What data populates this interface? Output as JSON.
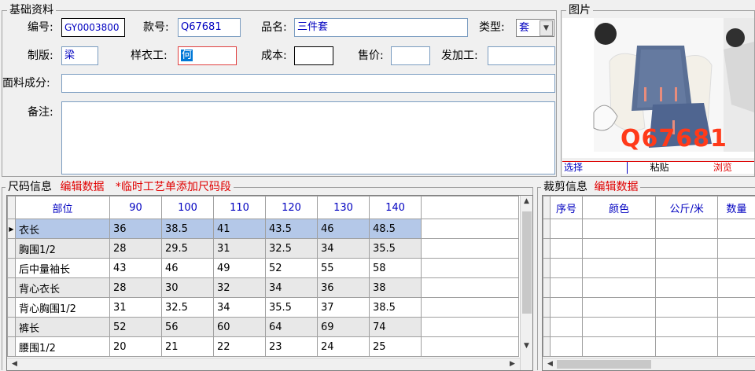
{
  "basic": {
    "title": "基础资料",
    "code_label": "编号:",
    "code_value": "GY0003800",
    "style_label": "款号:",
    "style_value": "Q67681",
    "name_label": "品名:",
    "name_value": "三件套",
    "type_label": "类型:",
    "type_value": "套",
    "pattern_label": "制版:",
    "pattern_value": "梁",
    "sample_label": "样衣工:",
    "sample_value": "何",
    "cost_label": "成本:",
    "cost_value": "",
    "price_label": "售价:",
    "price_value": "",
    "process_label": "发加工:",
    "process_value": "",
    "fabric_label": "面料成分:",
    "fabric_value": "",
    "note_label": "备注:",
    "note_value": ""
  },
  "picture": {
    "title": "图片",
    "caption": "Q67681",
    "select_label": "选择",
    "paste_label": "粘贴",
    "browse_label": "浏览"
  },
  "size": {
    "title": "尺码信息",
    "edit_label": "编辑数据",
    "note": "*临时工艺单添加尺码段",
    "columns": [
      "部位",
      "90",
      "100",
      "110",
      "120",
      "130",
      "140"
    ],
    "rows": [
      [
        "衣长",
        "36",
        "38.5",
        "41",
        "43.5",
        "46",
        "48.5"
      ],
      [
        "胸围1/2",
        "28",
        "29.5",
        "31",
        "32.5",
        "34",
        "35.5"
      ],
      [
        "后中量袖长",
        "43",
        "46",
        "49",
        "52",
        "55",
        "58"
      ],
      [
        "背心衣长",
        "28",
        "30",
        "32",
        "34",
        "36",
        "38"
      ],
      [
        "背心胸围1/2",
        "31",
        "32.5",
        "34",
        "35.5",
        "37",
        "38.5"
      ],
      [
        "裤长",
        "52",
        "56",
        "60",
        "64",
        "69",
        "74"
      ],
      [
        "腰围1/2",
        "20",
        "21",
        "22",
        "23",
        "24",
        "25"
      ]
    ]
  },
  "cut": {
    "title": "裁剪信息",
    "edit_label": "编辑数据",
    "columns": [
      "序号",
      "颜色",
      "公斤/米",
      "数量"
    ]
  },
  "colors": {
    "accent_red": "#e00000",
    "header_blue": "#0000c0",
    "selected_row": "#b4c8e8",
    "alt_row": "#e8e8e8"
  }
}
